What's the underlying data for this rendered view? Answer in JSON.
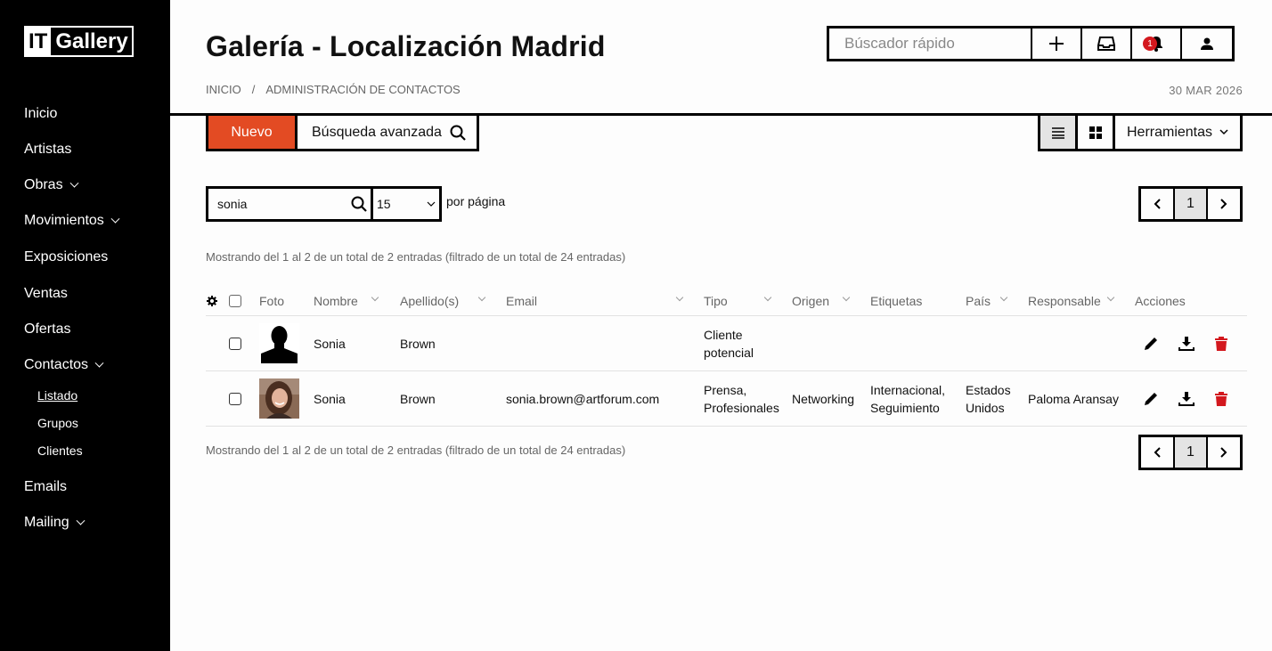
{
  "app": {
    "logo_it": "IT",
    "logo_name": "Gallery"
  },
  "sidebar": {
    "items": [
      {
        "label": "Inicio",
        "chevron": false
      },
      {
        "label": "Artistas",
        "chevron": false
      },
      {
        "label": "Obras",
        "chevron": true
      },
      {
        "label": "Movimientos",
        "chevron": true
      },
      {
        "label": "Exposiciones",
        "chevron": false
      },
      {
        "label": "Ventas",
        "chevron": false
      },
      {
        "label": "Ofertas",
        "chevron": false
      },
      {
        "label": "Contactos",
        "chevron": true
      },
      {
        "label": "Emails",
        "chevron": false
      },
      {
        "label": "Mailing",
        "chevron": true
      }
    ],
    "contactos_sub": [
      {
        "label": "Listado",
        "active": true
      },
      {
        "label": "Grupos",
        "active": false
      },
      {
        "label": "Clientes",
        "active": false
      }
    ]
  },
  "header": {
    "title": "Galería - Localización Madrid",
    "breadcrumb_home": "INICIO",
    "breadcrumb_sep": "/",
    "breadcrumb_current": "ADMINISTRACIÓN DE CONTACTOS",
    "date": "30 MAR 2026",
    "quick_search_placeholder": "Búscador rápido",
    "notification_count": "1"
  },
  "toolbar": {
    "new_label": "Nuevo",
    "advanced_search_label": "Búsqueda avanzada",
    "tools_label": "Herramientas"
  },
  "filters": {
    "search_value": "sonia",
    "per_page_value": "15",
    "per_page_label": "por página",
    "current_page": "1"
  },
  "info_text": "Mostrando del 1 al 2 de un total de 2 entradas (filtrado de un total de 24 entradas)",
  "table": {
    "columns": {
      "foto": "Foto",
      "nombre": "Nombre",
      "apellido": "Apellido(s)",
      "email": "Email",
      "tipo": "Tipo",
      "origen": "Origen",
      "etiquetas": "Etiquetas",
      "pais": "País",
      "responsable": "Responsable",
      "acciones": "Acciones"
    },
    "rows": [
      {
        "photo": "silhouette",
        "nombre": "Sonia",
        "apellido": "Brown",
        "email": "",
        "tipo_1": "Cliente",
        "tipo_2": "potencial",
        "origen": "",
        "etiquetas_1": "",
        "etiquetas_2": "",
        "pais_1": "",
        "pais_2": "",
        "responsable": ""
      },
      {
        "photo": "portrait",
        "nombre": "Sonia",
        "apellido": "Brown",
        "email": "sonia.brown@artforum.com",
        "tipo_1": "Prensa,",
        "tipo_2": "Profesionales",
        "origen": "Networking",
        "etiquetas_1": "Internacional,",
        "etiquetas_2": "Seguimiento",
        "pais_1": "Estados",
        "pais_2": "Unidos",
        "responsable": "Paloma Aransay"
      }
    ]
  },
  "colors": {
    "accent": "#e34b23",
    "danger": "#d3181e",
    "sidebar_bg": "#000000"
  },
  "icons": [
    "plus-icon",
    "inbox-icon",
    "bell-icon",
    "user-icon",
    "search-icon",
    "list-view-icon",
    "grid-view-icon",
    "chevron-down-icon",
    "chevron-left-icon",
    "chevron-right-icon",
    "gear-icon",
    "edit-icon",
    "download-icon",
    "trash-icon"
  ]
}
